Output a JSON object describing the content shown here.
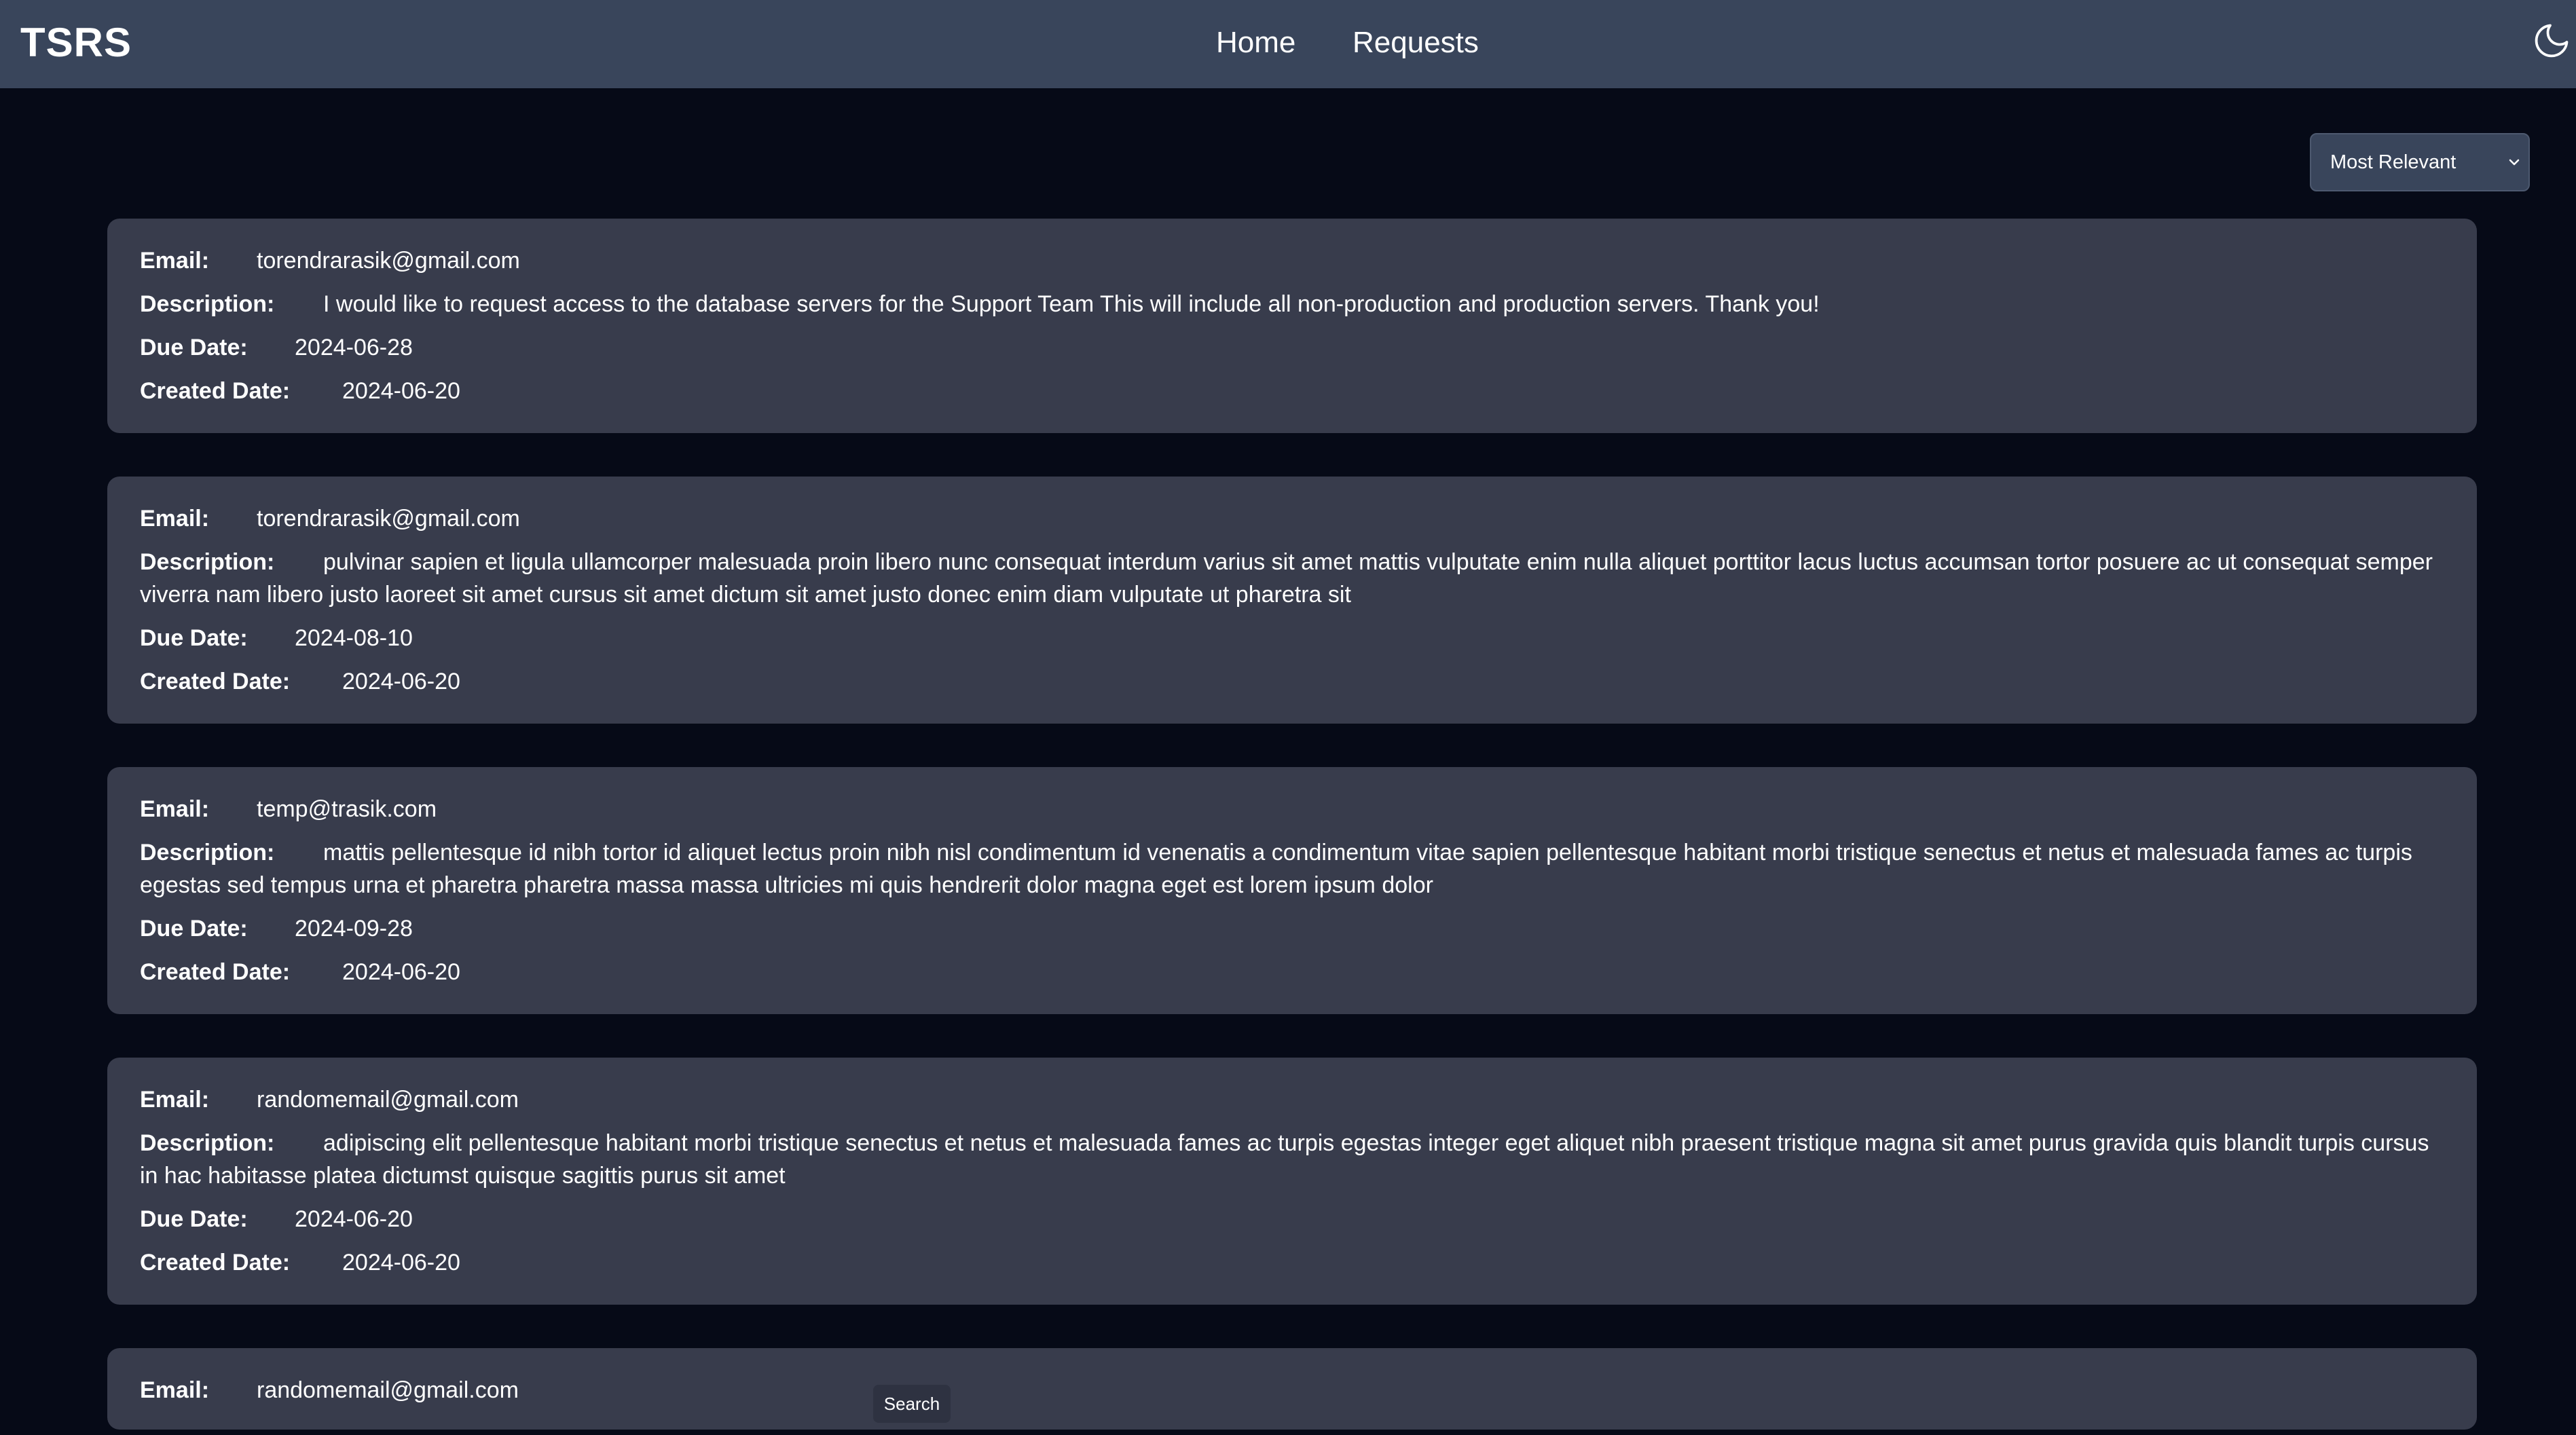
{
  "app": {
    "brand": "TSRS"
  },
  "nav": {
    "home": "Home",
    "requests": "Requests"
  },
  "icons": {
    "theme_toggle": "moon-icon",
    "sort_chevron": "chevron-down-icon"
  },
  "sort": {
    "selected": "Most Relevant"
  },
  "labels": {
    "email": "Email:",
    "description": "Description:",
    "due_date": "Due Date:",
    "created_date": "Created Date:"
  },
  "requests": [
    {
      "email": "torendrarasik@gmail.com",
      "description": "I would like to request access to the database servers for the Support Team This will include all non-production and production servers. Thank you!",
      "due_date": "2024-06-28",
      "created_date": "2024-06-20"
    },
    {
      "email": "torendrarasik@gmail.com",
      "description": "pulvinar sapien et ligula ullamcorper malesuada proin libero nunc consequat interdum varius sit amet mattis vulputate enim nulla aliquet porttitor lacus luctus accumsan tortor posuere ac ut consequat semper viverra nam libero justo laoreet sit amet cursus sit amet dictum sit amet justo donec enim diam vulputate ut pharetra sit",
      "due_date": "2024-08-10",
      "created_date": "2024-06-20"
    },
    {
      "email": "temp@trasik.com",
      "description": "mattis pellentesque id nibh tortor id aliquet lectus proin nibh nisl condimentum id venenatis a condimentum vitae sapien pellentesque habitant morbi tristique senectus et netus et malesuada fames ac turpis egestas sed tempus urna et pharetra pharetra massa massa ultricies mi quis hendrerit dolor magna eget est lorem ipsum dolor",
      "due_date": "2024-09-28",
      "created_date": "2024-06-20"
    },
    {
      "email": "randomemail@gmail.com",
      "description": "adipiscing elit pellentesque habitant morbi tristique senectus et netus et malesuada fames ac turpis egestas integer eget aliquet nibh praesent tristique magna sit amet purus gravida quis blandit turpis cursus in hac habitasse platea dictumst quisque sagittis purus sit amet",
      "due_date": "2024-06-20",
      "created_date": "2024-06-20"
    },
    {
      "email": "randomemail@gmail.com"
    }
  ],
  "tooltip": {
    "text": "Search"
  }
}
